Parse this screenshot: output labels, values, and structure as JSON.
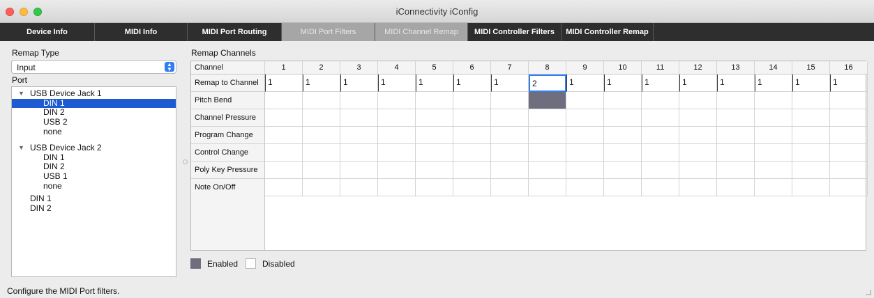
{
  "window": {
    "title": "iConnectivity iConfig"
  },
  "tabs": [
    {
      "label": "Device Info",
      "state": "normal"
    },
    {
      "label": "MIDI Info",
      "state": "normal"
    },
    {
      "label": "MIDI Port Routing",
      "state": "normal"
    },
    {
      "label": "MIDI Port Filters",
      "state": "disabled"
    },
    {
      "label": "MIDI Channel Remap",
      "state": "disabled"
    },
    {
      "label": "MIDI Controller Filters",
      "state": "normal"
    },
    {
      "label": "MIDI Controller Remap",
      "state": "normal"
    }
  ],
  "remap_type": {
    "label": "Remap Type",
    "value": "Input"
  },
  "port": {
    "label": "Port",
    "tree": [
      {
        "label": "USB Device Jack 1",
        "level": 0,
        "expanded": true,
        "selected": false
      },
      {
        "label": "DIN 1",
        "level": 1,
        "selected": true
      },
      {
        "label": "DIN 2",
        "level": 1,
        "selected": false
      },
      {
        "label": "USB 2",
        "level": 1,
        "selected": false
      },
      {
        "label": "none",
        "level": 1,
        "selected": false
      },
      {
        "label": "USB Device Jack 2",
        "level": 0,
        "expanded": true,
        "selected": false
      },
      {
        "label": "DIN 1",
        "level": 1,
        "selected": false
      },
      {
        "label": "DIN 2",
        "level": 1,
        "selected": false
      },
      {
        "label": "USB 1",
        "level": 1,
        "selected": false
      },
      {
        "label": "none",
        "level": 1,
        "selected": false
      },
      {
        "label": "DIN 1",
        "level": 0,
        "selected": false
      },
      {
        "label": "DIN 2",
        "level": 0,
        "selected": false
      }
    ]
  },
  "remap_channels": {
    "title": "Remap Channels",
    "header_label": "Channel",
    "channels": [
      "1",
      "2",
      "3",
      "4",
      "5",
      "6",
      "7",
      "8",
      "9",
      "10",
      "11",
      "12",
      "13",
      "14",
      "15",
      "16"
    ],
    "remap_label": "Remap to Channel",
    "remap_values": [
      "1",
      "1",
      "1",
      "1",
      "1",
      "1",
      "1",
      "2",
      "1",
      "1",
      "1",
      "1",
      "1",
      "1",
      "1",
      "1"
    ],
    "focused_channel_index": 7,
    "rows": [
      {
        "label": "Pitch Bend",
        "enabled": [
          false,
          false,
          false,
          false,
          false,
          false,
          false,
          true,
          false,
          false,
          false,
          false,
          false,
          false,
          false,
          false
        ]
      },
      {
        "label": "Channel Pressure",
        "enabled": [
          false,
          false,
          false,
          false,
          false,
          false,
          false,
          false,
          false,
          false,
          false,
          false,
          false,
          false,
          false,
          false
        ]
      },
      {
        "label": "Program Change",
        "enabled": [
          false,
          false,
          false,
          false,
          false,
          false,
          false,
          false,
          false,
          false,
          false,
          false,
          false,
          false,
          false,
          false
        ]
      },
      {
        "label": "Control Change",
        "enabled": [
          false,
          false,
          false,
          false,
          false,
          false,
          false,
          false,
          false,
          false,
          false,
          false,
          false,
          false,
          false,
          false
        ]
      },
      {
        "label": "Poly Key Pressure",
        "enabled": [
          false,
          false,
          false,
          false,
          false,
          false,
          false,
          false,
          false,
          false,
          false,
          false,
          false,
          false,
          false,
          false
        ]
      },
      {
        "label": "Note On/Off",
        "enabled": [
          false,
          false,
          false,
          false,
          false,
          false,
          false,
          false,
          false,
          false,
          false,
          false,
          false,
          false,
          false,
          false
        ]
      }
    ]
  },
  "legend": {
    "enabled_label": "Enabled",
    "disabled_label": "Disabled",
    "enabled_color": "#6e6e7e",
    "disabled_color": "#ffffff"
  },
  "status": {
    "text": "Configure the MIDI Port filters."
  }
}
